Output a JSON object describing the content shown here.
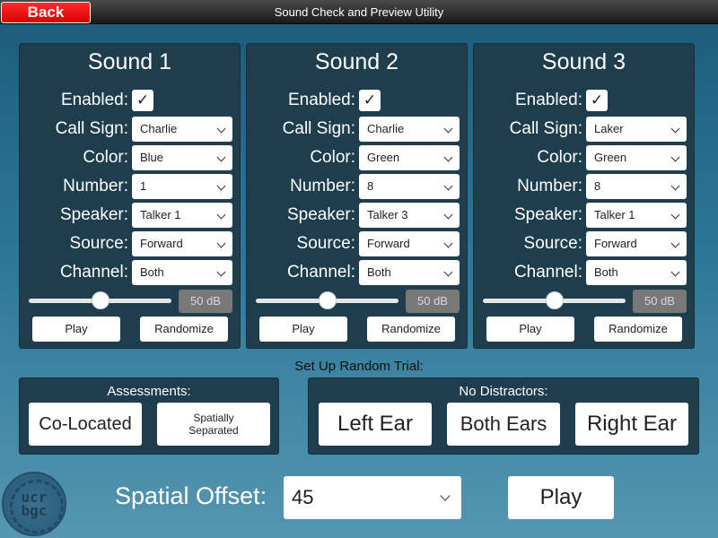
{
  "header": {
    "back_label": "Back",
    "title": "Sound Check and Preview Utility"
  },
  "labels": {
    "enabled": "Enabled:",
    "call_sign": "Call Sign:",
    "color": "Color:",
    "number": "Number:",
    "speaker": "Speaker:",
    "source": "Source:",
    "channel": "Channel:"
  },
  "sounds": [
    {
      "title": "Sound 1",
      "enabled_mark": "✓",
      "call_sign": "Charlie",
      "color": "Blue",
      "number": "1",
      "speaker": "Talker 1",
      "source": "Forward",
      "channel": "Both",
      "volume_label": "50 dB",
      "volume_level": 0.5,
      "play_label": "Play",
      "randomize_label": "Randomize"
    },
    {
      "title": "Sound 2",
      "enabled_mark": "✓",
      "call_sign": "Charlie",
      "color": "Green",
      "number": "8",
      "speaker": "Talker 3",
      "source": "Forward",
      "channel": "Both",
      "volume_label": "50 dB",
      "volume_level": 0.5,
      "play_label": "Play",
      "randomize_label": "Randomize"
    },
    {
      "title": "Sound 3",
      "enabled_mark": "✓",
      "call_sign": "Laker",
      "color": "Green",
      "number": "8",
      "speaker": "Talker 1",
      "source": "Forward",
      "channel": "Both",
      "volume_label": "50 dB",
      "volume_level": 0.5,
      "play_label": "Play",
      "randomize_label": "Randomize"
    }
  ],
  "random_trial": {
    "heading": "Set Up Random Trial:",
    "assessments": {
      "title": "Assessments:",
      "co_located": "Co-Located",
      "spatially_separated_1": "Spatially",
      "spatially_separated_2": "Separated"
    },
    "no_distractors": {
      "title": "No Distractors:",
      "left_ear": "Left Ear",
      "both_ears": "Both Ears",
      "right_ear": "Right Ear"
    }
  },
  "logo": {
    "line1": "ucr",
    "line2": "bgc"
  },
  "spatial_offset": {
    "label": "Spatial Offset:",
    "value": "45"
  },
  "play_label": "Play",
  "colors": {
    "panel": "#1e3d4d",
    "back_button": "#e60000",
    "db_box": "#787878"
  }
}
